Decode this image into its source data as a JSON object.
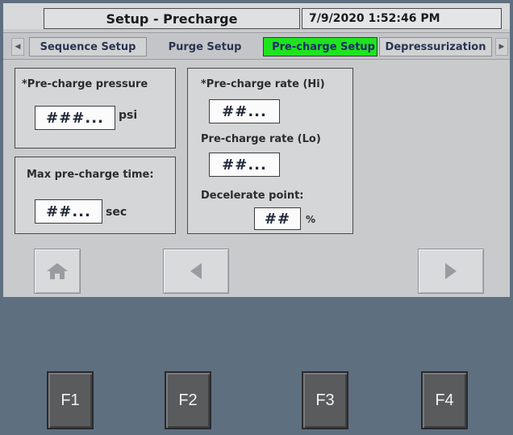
{
  "header": {
    "title": "Setup - Precharge",
    "datetime": "7/9/2020 1:52:46 PM"
  },
  "tabs": [
    {
      "label": "Sequence Setup",
      "active": false
    },
    {
      "label": "Purge Setup",
      "active": false
    },
    {
      "label": "Pre-charge Setup",
      "active": true
    },
    {
      "label": "Depressurization",
      "active": false
    }
  ],
  "pressure_panel": {
    "label": "*Pre-charge pressure",
    "value": "###...",
    "unit": "psi"
  },
  "time_panel": {
    "label": "Max pre-charge time:",
    "value": "##...",
    "unit": "sec"
  },
  "rate_panel": {
    "rate_hi_label": "*Pre-charge rate (Hi)",
    "rate_hi_value": "##...",
    "rate_lo_label": "Pre-charge rate (Lo)",
    "rate_lo_value": "##...",
    "decel_label": "Decelerate point:",
    "decel_value": "##",
    "decel_unit": "%"
  },
  "nav": {
    "home_icon": "home-icon",
    "prev_icon": "triangle-left-icon",
    "next_icon": "triangle-right-icon"
  },
  "function_keys": [
    "F1",
    "F2",
    "F3",
    "F4"
  ],
  "colors": {
    "active_tab": "#1fe31f",
    "screen_bg": "#c9cacc",
    "bezel": "#5e6f80"
  }
}
